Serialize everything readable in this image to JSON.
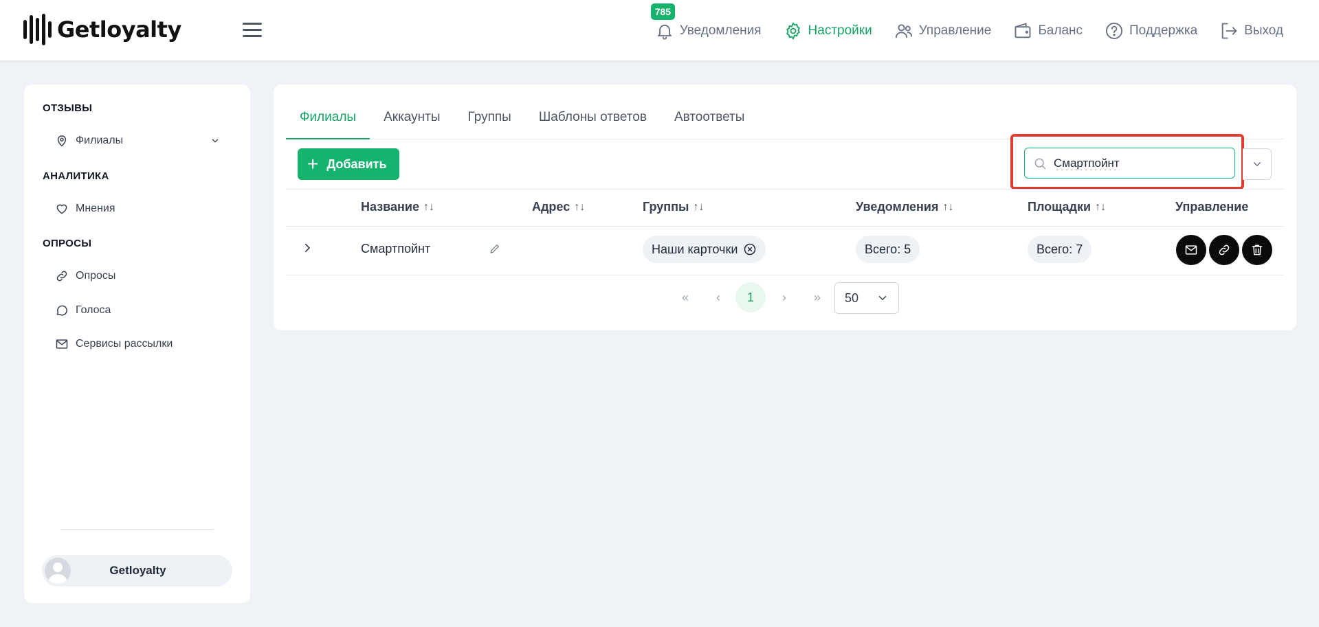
{
  "header": {
    "logo_text": "Getloyalty",
    "nav": {
      "notifications": {
        "label": "Уведомления",
        "badge": "785"
      },
      "settings": {
        "label": "Настройки"
      },
      "management": {
        "label": "Управление"
      },
      "balance": {
        "label": "Баланс"
      },
      "support": {
        "label": "Поддержка"
      },
      "logout": {
        "label": "Выход"
      }
    }
  },
  "sidebar": {
    "section_reviews": "ОТЗЫВЫ",
    "item_branches": "Филиалы",
    "section_analytics": "АНАЛИТИКА",
    "item_opinions": "Мнения",
    "section_polls": "ОПРОСЫ",
    "item_polls": "Опросы",
    "item_votes": "Голоса",
    "item_mailing": "Сервисы рассылки",
    "user_name": "Getloyalty"
  },
  "tabs": [
    "Филиалы",
    "Аккаунты",
    "Группы",
    "Шаблоны ответов",
    "Автоответы"
  ],
  "toolbar": {
    "add_label": "Добавить",
    "search_value": "Смартпойнт"
  },
  "table": {
    "columns": {
      "name": "Название",
      "address": "Адрес",
      "groups": "Группы",
      "notifications": "Уведомления",
      "platforms": "Площадки",
      "management": "Управление"
    },
    "sort_glyph": "↑↓",
    "rows": [
      {
        "name": "Смартпойнт",
        "address": "",
        "group_chip": "Наши карточки",
        "notifications": "Всего: 5",
        "platforms": "Всего: 7"
      }
    ]
  },
  "pagination": {
    "first": "«",
    "prev": "‹",
    "current": "1",
    "next": "›",
    "last": "»",
    "per_page": "50"
  },
  "colors": {
    "accent": "#16a362",
    "button_green": "#16b36e",
    "highlight_red": "#e03a2f",
    "background": "#eff2f7"
  }
}
